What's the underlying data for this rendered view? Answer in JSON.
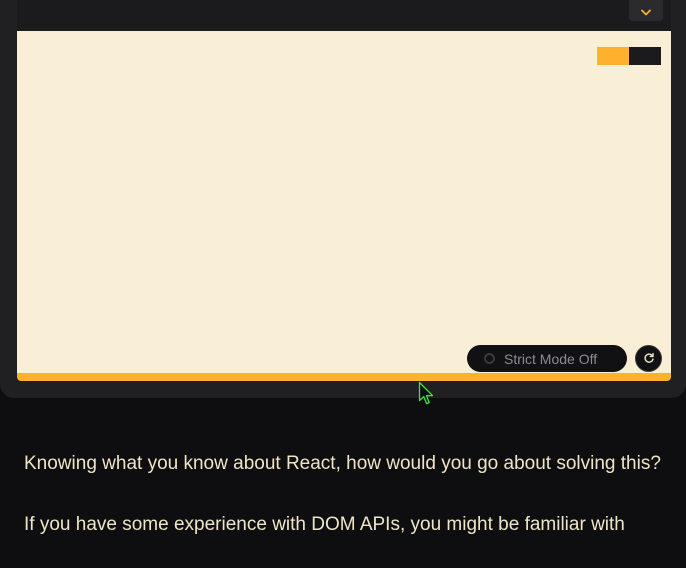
{
  "playground": {
    "strict_mode_label": "Strict Mode Off",
    "swatches": [
      "#fdb12c",
      "#1b1a1d"
    ],
    "accent_color": "#fdb12c",
    "preview_background": "#f8efd6"
  },
  "icons": {
    "dropdown": "chevron-down-icon",
    "refresh": "refresh-icon",
    "toggle": "toggle-ring-icon",
    "cursor": "mouse-pointer-icon"
  },
  "article": {
    "paragraph_1": "Knowing what you know about React, how would you go about solving this?",
    "paragraph_2": "If you have some experience with DOM APIs, you might be familiar with"
  }
}
